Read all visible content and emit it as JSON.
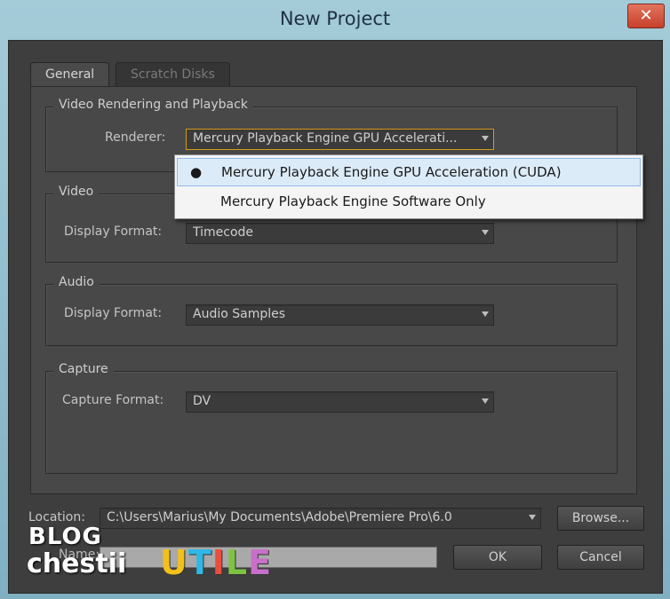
{
  "window": {
    "title": "New Project",
    "close_glyph": "✕"
  },
  "tabs": [
    {
      "label": "General",
      "active": true
    },
    {
      "label": "Scratch Disks",
      "active": false
    }
  ],
  "video_rendering": {
    "title": "Video Rendering and Playback",
    "renderer_label": "Renderer:",
    "renderer_value": "Mercury Playback Engine GPU Accelerati...",
    "options": [
      {
        "label": "Mercury Playback Engine GPU Acceleration (CUDA)",
        "selected": true,
        "mark": "●"
      },
      {
        "label": "Mercury Playback Engine Software Only",
        "selected": false,
        "mark": ""
      }
    ]
  },
  "video": {
    "title": "Video",
    "display_format_label": "Display Format:",
    "display_format_value": "Timecode"
  },
  "audio": {
    "title": "Audio",
    "display_format_label": "Display Format:",
    "display_format_value": "Audio Samples"
  },
  "capture": {
    "title": "Capture",
    "capture_format_label": "Capture Format:",
    "capture_format_value": "DV"
  },
  "location": {
    "label": "Location:",
    "value": "C:\\Users\\Marius\\My Documents\\Adobe\\Premiere Pro\\6.0",
    "browse_label": "Browse..."
  },
  "name": {
    "label": "Name:",
    "value": ""
  },
  "buttons": {
    "ok": "OK",
    "cancel": "Cancel"
  },
  "watermark": {
    "line1": "BLOG",
    "line2": "chestii",
    "letters": [
      {
        "ch": "U",
        "color": "#f2c01c"
      },
      {
        "ch": "T",
        "color": "#2fb8e6"
      },
      {
        "ch": "I",
        "color": "#e94f3d"
      },
      {
        "ch": "L",
        "color": "#7fc241"
      },
      {
        "ch": "E",
        "color": "#c86fc9"
      }
    ]
  },
  "icons": {
    "dropdown": "chevron-down-icon",
    "close": "close-icon"
  }
}
